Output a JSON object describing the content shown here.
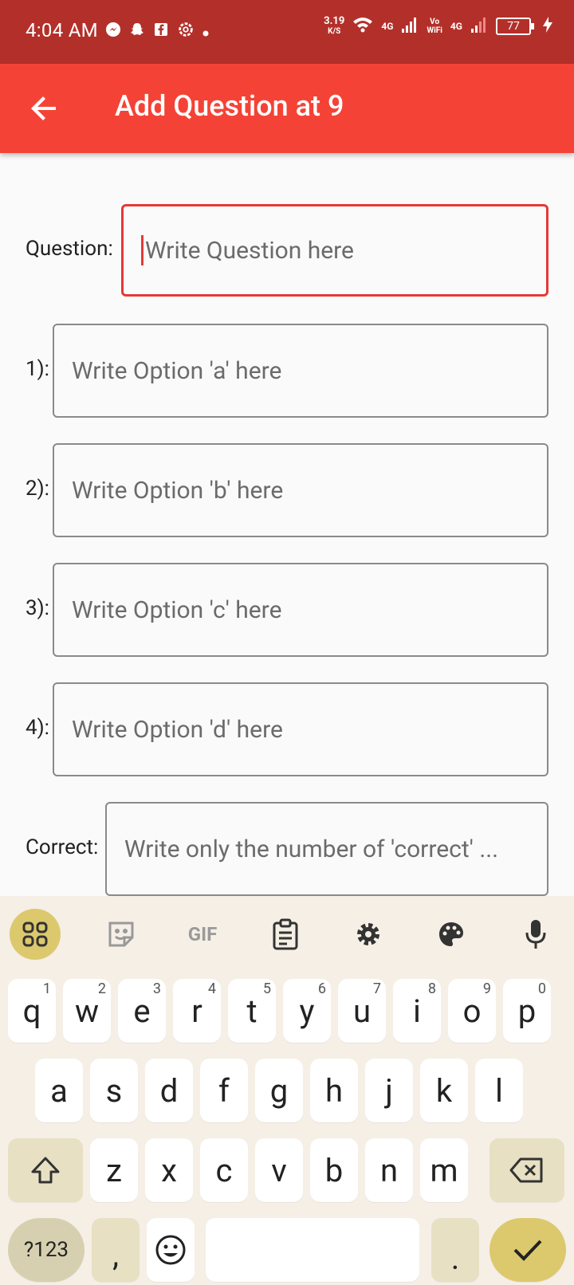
{
  "status_bar": {
    "time": "4:04 AM",
    "speed_value": "3.19",
    "speed_unit": "K/S",
    "network1": "4G",
    "volte": "Vo",
    "wifi_label": "WiFi",
    "network2": "4G",
    "battery": "77"
  },
  "app_bar": {
    "title": "Add Question at 9"
  },
  "form": {
    "question_label": "Question:",
    "question_placeholder": "Write Question here",
    "option1_label": "1):",
    "option1_placeholder": "Write Option 'a' here",
    "option2_label": "2):",
    "option2_placeholder": "Write Option 'b' here",
    "option3_label": "3):",
    "option3_placeholder": "Write Option 'c' here",
    "option4_label": "4):",
    "option4_placeholder": "Write Option 'd' here",
    "correct_label": "Correct:",
    "correct_placeholder": "Write only the number of 'correct' ..."
  },
  "keyboard": {
    "toolbar": {
      "gif_label": "GIF"
    },
    "row1": [
      "q",
      "w",
      "e",
      "r",
      "t",
      "y",
      "u",
      "i",
      "o",
      "p"
    ],
    "row1_hints": [
      "1",
      "2",
      "3",
      "4",
      "5",
      "6",
      "7",
      "8",
      "9",
      "0"
    ],
    "row2": [
      "a",
      "s",
      "d",
      "f",
      "g",
      "h",
      "j",
      "k",
      "l"
    ],
    "row3": [
      "z",
      "x",
      "c",
      "v",
      "b",
      "n",
      "m"
    ],
    "symbols_label": "?123",
    "comma": ",",
    "period": "."
  },
  "colors": {
    "status_bar": "#b3302a",
    "app_bar": "#f44336",
    "accent": "#e53935",
    "keyboard_bg": "#f5efe6",
    "keyboard_accent": "#dcc96d"
  }
}
